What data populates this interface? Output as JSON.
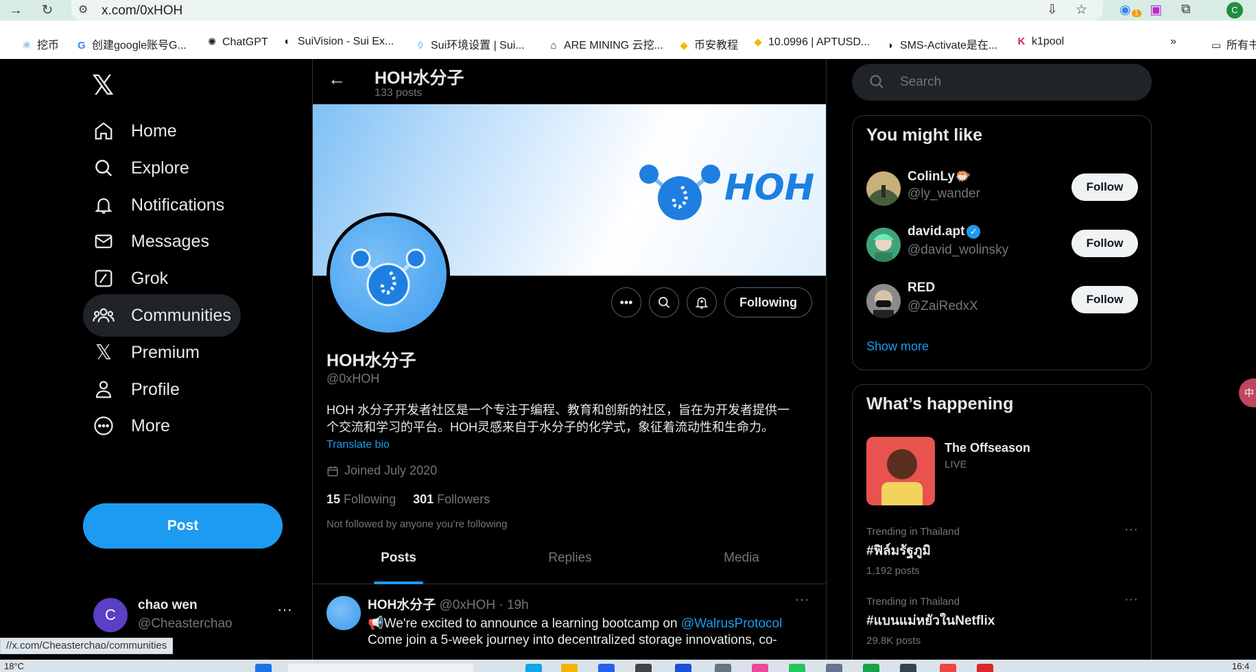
{
  "browser": {
    "url": "x.com/0xHOH",
    "bookmarks": [
      {
        "label": "挖币",
        "icon": "react-icon"
      },
      {
        "label": "创建google账号G...",
        "icon": "google-icon"
      },
      {
        "label": "ChatGPT",
        "icon": "openai-icon"
      },
      {
        "label": "SuiVision - Sui Ex...",
        "icon": "suivision-icon"
      },
      {
        "label": "Sui环境设置 | Sui...",
        "icon": "sui-drop-icon"
      },
      {
        "label": "ARE MINING 云挖...",
        "icon": "mining-icon"
      },
      {
        "label": "币安教程",
        "icon": "binance-icon"
      },
      {
        "label": "10.0996 | APTUSD...",
        "icon": "binance-icon"
      },
      {
        "label": "SMS-Activate是在...",
        "icon": "sms-icon"
      },
      {
        "label": "k1pool",
        "icon": "k1-icon"
      }
    ],
    "bookmarks_overflow": "»",
    "bookmarks_all": "所有书",
    "profile_initial": "C",
    "ext_badge": "1"
  },
  "nav": {
    "items": [
      {
        "label": "Home",
        "icon": "home-icon"
      },
      {
        "label": "Explore",
        "icon": "explore-icon"
      },
      {
        "label": "Notifications",
        "icon": "bell-icon"
      },
      {
        "label": "Messages",
        "icon": "mail-icon"
      },
      {
        "label": "Grok",
        "icon": "grok-icon"
      },
      {
        "label": "Communities",
        "icon": "communities-icon"
      },
      {
        "label": "Premium",
        "icon": "x-premium-icon"
      },
      {
        "label": "Profile",
        "icon": "person-icon"
      },
      {
        "label": "More",
        "icon": "more-circle-icon"
      }
    ],
    "post_label": "Post",
    "account": {
      "initial": "C",
      "name": "chao wen",
      "handle": "@Cheasterchao",
      "dots": "···"
    }
  },
  "main": {
    "header_title": "HOH水分子",
    "header_count": "133 posts",
    "banner_text": "HOH",
    "following_label": "Following",
    "profile": {
      "name": "HOH水分子",
      "handle": "@0xHOH",
      "bio_line1": "HOH 水分子开发者社区是一个专注于编程、教育和创新的社区，旨在为开发者提供一",
      "bio_line2": "个交流和学习的平台。HOH灵感来自于水分子的化学式，象征着流动性和生命力。",
      "translate": "Translate bio",
      "joined": "Joined July 2020",
      "following_count": "15",
      "following_label": "Following",
      "followers_count": "301",
      "followers_label": "Followers",
      "not_followed": "Not followed by anyone you’re following"
    },
    "tabs": [
      "Posts",
      "Replies",
      "Media"
    ],
    "tweet": {
      "name": "HOH水分子",
      "meta": "@0xHOH · 19h",
      "line1_prefix": "📢We're excited to announce a learning bootcamp on ",
      "mention": "@WalrusProtocol",
      "line2": "Come join a 5-week journey into decentralized storage innovations, co-"
    }
  },
  "right": {
    "search_placeholder": "Search",
    "wtf_title": "You might like",
    "suggestions": [
      {
        "name": "ColinLy🐡",
        "handle": "@ly_wander",
        "follow": "Follow",
        "verified": false
      },
      {
        "name": "david.apt",
        "handle": "@david_wolinsky",
        "follow": "Follow",
        "verified": true
      },
      {
        "name": "RED",
        "handle": "@ZaiRedxX",
        "follow": "Follow",
        "verified": false
      }
    ],
    "show_more": "Show more",
    "happening_title": "What’s happening",
    "event": {
      "title": "The Offseason",
      "status": "LIVE"
    },
    "trends": [
      {
        "context": "Trending in Thailand",
        "title": "#ฟิล์มรัฐภูมิ",
        "posts": "1,192 posts"
      },
      {
        "context": "Trending in Thailand",
        "title": "#แบนแม่หยัวในNetflix",
        "posts": "29.8K posts"
      }
    ]
  },
  "status_link": "//x.com/Cheasterchao/communities",
  "taskbar": {
    "temp": "18°C",
    "clock": "16:4"
  },
  "colors": {
    "accent": "#1d9bf0",
    "background": "#000000",
    "muted": "#71767b"
  }
}
